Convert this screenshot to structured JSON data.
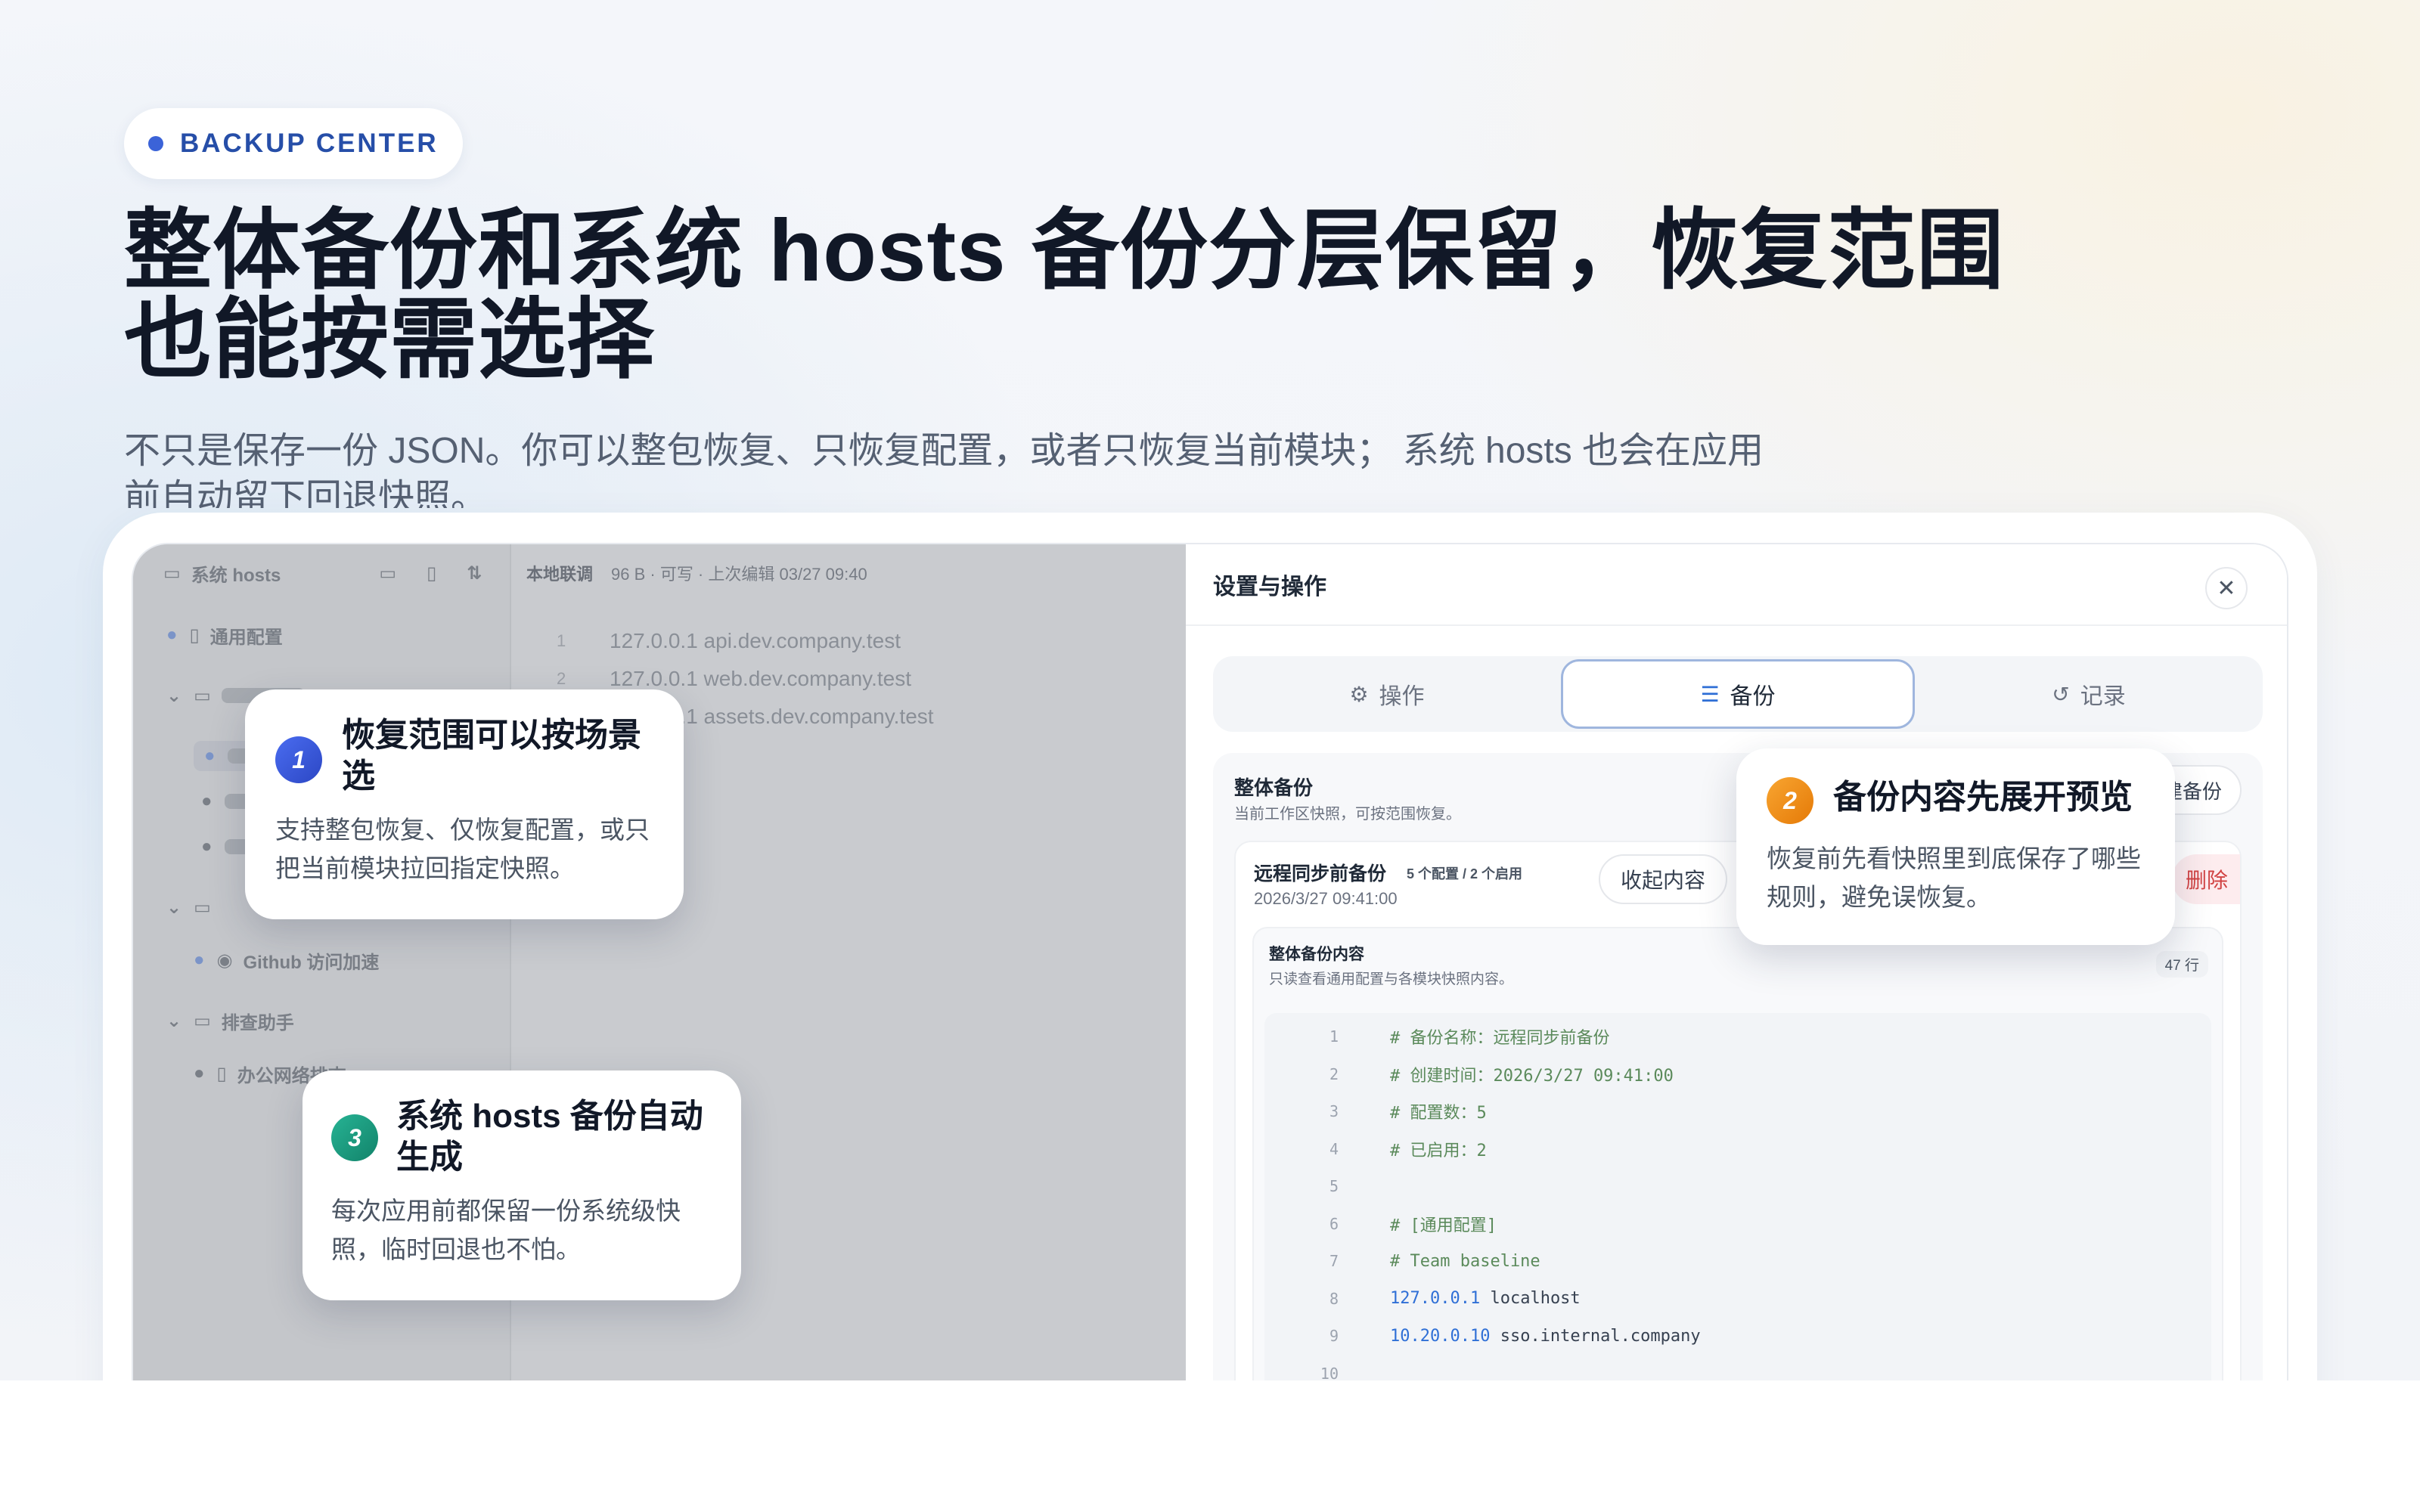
{
  "badge": "BACKUP CENTER",
  "title": "整体备份和系统 hosts 备份分层保留，恢复范围也能按需选择",
  "subtitle": "不只是保存一份 JSON。你可以整包恢复、只恢复配置，或者只恢复当前模块； 系统 hosts 也会在应用前自动留下回退快照。",
  "left_app": {
    "sidebar_title": "系统 hosts",
    "sidebar_items": [
      {
        "label": "通用配置"
      },
      {
        "label": "Github 访问加速"
      },
      {
        "label": "排查助手"
      },
      {
        "label": "办公网络排查"
      }
    ],
    "editor_header": "本地联调",
    "editor_meta": "96 B · 可写 · 上次编辑 03/27 09:40",
    "editor_lines": [
      "127.0.0.1 api.dev.company.test",
      "127.0.0.1 web.dev.company.test",
      "127.0.0.1 assets.dev.company.test"
    ]
  },
  "panel": {
    "header": "设置与操作",
    "tabs": [
      {
        "label": "操作",
        "icon": "sliders-icon"
      },
      {
        "label": "备份",
        "icon": "database-icon"
      },
      {
        "label": "记录",
        "icon": "history-icon"
      }
    ],
    "section_title": "整体备份",
    "section_desc": "当前工作区快照，可按范围恢复。",
    "section_button": "创建备份",
    "item": {
      "name": "远程同步前备份",
      "tag": "5 个配置 / 2 个启用",
      "time": "2026/3/27 09:41:00",
      "collapse": "收起内容",
      "delete": "删除"
    },
    "content": {
      "title": "整体备份内容",
      "desc": "只读查看通用配置与各模块快照内容。",
      "lines_badge": "47 行",
      "code": [
        {
          "n": "1",
          "t": "# 备份名称：远程同步前备份",
          "k": "cm"
        },
        {
          "n": "2",
          "t": "# 创建时间：2026/3/27 09:41:00",
          "k": "cm"
        },
        {
          "n": "3",
          "t": "# 配置数：5",
          "k": "cm"
        },
        {
          "n": "4",
          "t": "# 已启用：2",
          "k": "cm"
        },
        {
          "n": "5",
          "t": "",
          "k": "cm"
        },
        {
          "n": "6",
          "t": "# [通用配置]",
          "k": "cm"
        },
        {
          "n": "7",
          "t": "# Team baseline",
          "k": "cm"
        },
        {
          "n": "8",
          "ip": "127.0.0.1",
          "host": "localhost",
          "k": "host"
        },
        {
          "n": "9",
          "ip": "10.20.0.10",
          "host": "sso.internal.company",
          "k": "host"
        },
        {
          "n": "10",
          "t": "",
          "k": "cm"
        }
      ]
    }
  },
  "callouts": [
    {
      "num": "1",
      "title": "恢复范围可以按场景选",
      "desc": "支持整包恢复、仅恢复配置，或只把当前模块拉回指定快照。",
      "color": "#3a5bd9"
    },
    {
      "num": "2",
      "title": "备份内容先展开预览",
      "desc": "恢复前先看快照里到底保存了哪些规则，避免误恢复。",
      "color": "#f08a0c"
    },
    {
      "num": "3",
      "title": "系统 hosts 备份自动生成",
      "desc": "每次应用前都保留一份系统级快照，临时回退也不怕。",
      "color": "#1a9b7e"
    }
  ]
}
